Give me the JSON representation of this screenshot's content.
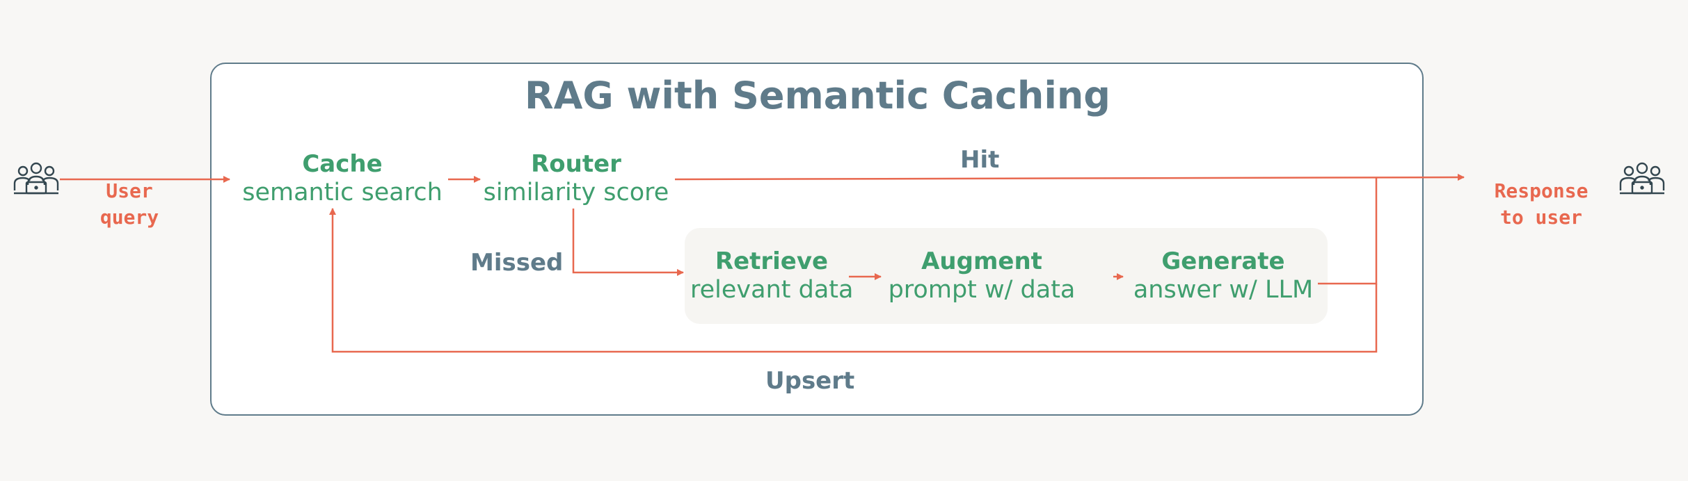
{
  "title": "RAG with Semantic Caching",
  "input": {
    "line1": "User",
    "line2": "query"
  },
  "output": {
    "line1": "Response",
    "line2": "to user"
  },
  "nodes": {
    "cache": {
      "name": "Cache",
      "desc": "semantic search"
    },
    "router": {
      "name": "Router",
      "desc": "similarity score"
    },
    "retrieve": {
      "name": "Retrieve",
      "desc": "relevant data"
    },
    "augment": {
      "name": "Augment",
      "desc": "prompt w/ data"
    },
    "generate": {
      "name": "Generate",
      "desc": "answer w/ LLM"
    }
  },
  "edges": {
    "hit": "Hit",
    "missed": "Missed",
    "upsert": "Upsert"
  },
  "icons": {
    "user": "users-laptop-icon"
  },
  "colors": {
    "accent": "#e8684f",
    "node": "#3f9e6e",
    "label": "#5f7b8a",
    "border": "#5f7b8a"
  }
}
